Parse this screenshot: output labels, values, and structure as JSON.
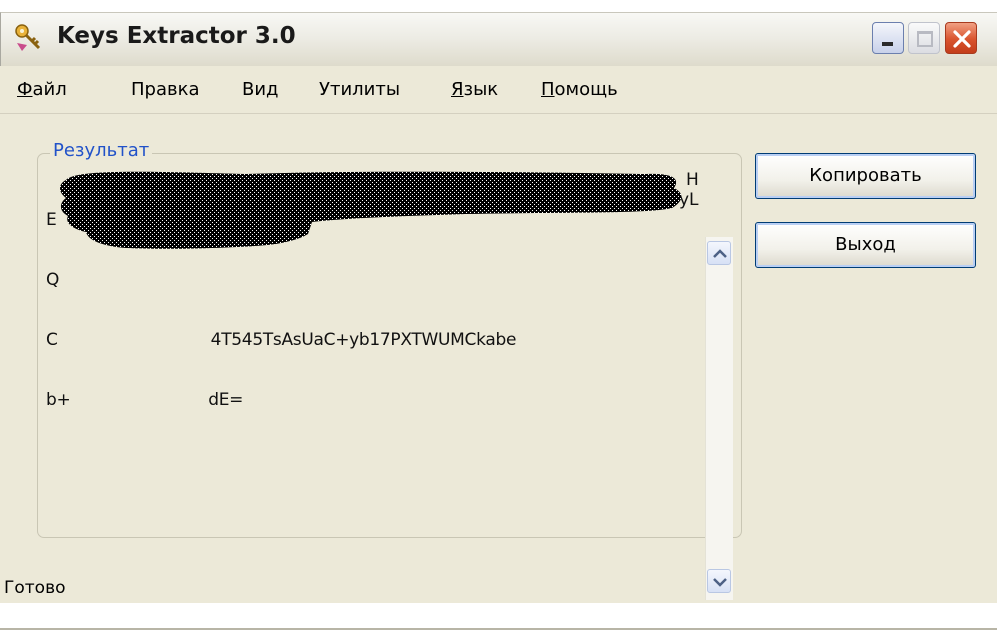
{
  "window": {
    "title": "Keys Extractor 3.0",
    "icon": "keys-extractor-app-icon",
    "controls": [
      "minimize-icon",
      "maximize-icon",
      "close-icon"
    ]
  },
  "menu": {
    "file": "Файл",
    "edit": "Правка",
    "view": "Вид",
    "utils": "Утилиты",
    "language": "Язык",
    "help": "Помощь"
  },
  "result": {
    "group_label": "Результат",
    "lines": [
      "E",
      "Q",
      "C                              4Т545ТsAsUaC+yb17PXTWUMCkabe",
      "b+                           dE="
    ],
    "line_tails": [
      "H",
      "yL"
    ],
    "redacted": true
  },
  "buttons": {
    "copy": "Копировать",
    "exit": "Выход"
  },
  "status": {
    "text": "Готово"
  },
  "colors": {
    "client_bg": "#ece9d8",
    "group_label": "#2152c9",
    "button_border": "#003c74",
    "close_button": "#d9532d"
  }
}
